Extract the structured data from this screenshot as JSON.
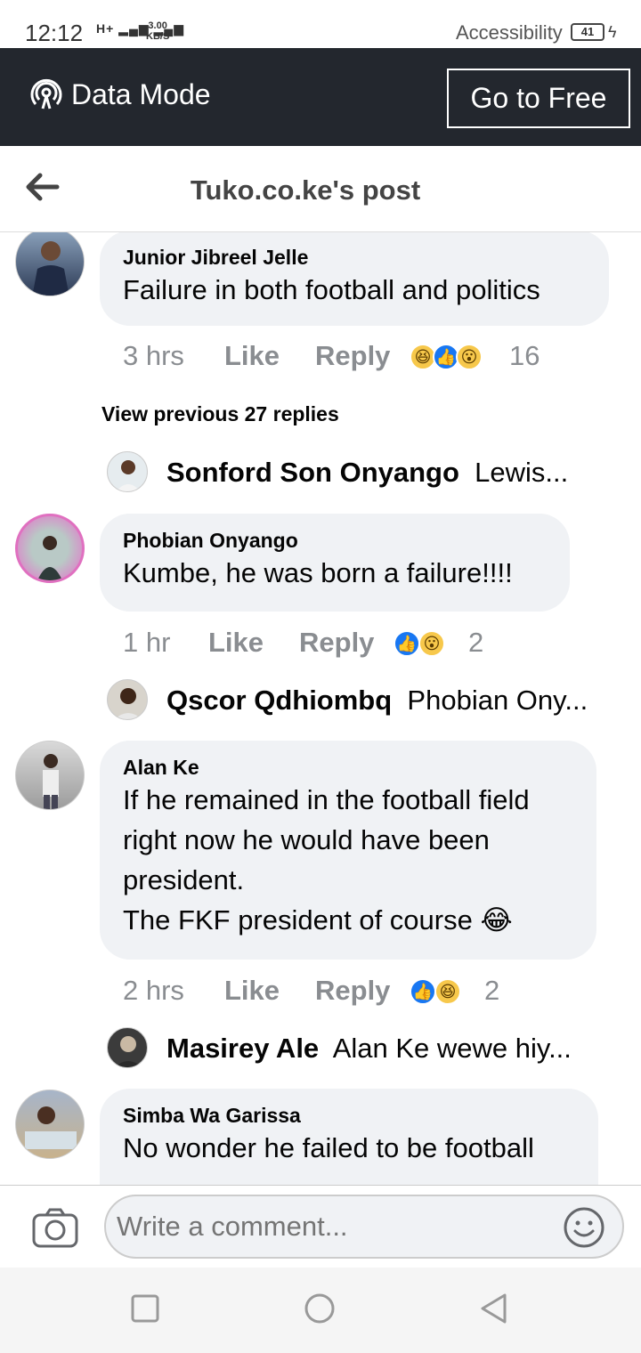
{
  "status": {
    "time": "12:12",
    "network": "H+",
    "speed_value": "3.00",
    "speed_unit": "KB/S",
    "accessibility": "Accessibility",
    "battery": "41"
  },
  "databar": {
    "label": "Data Mode",
    "button": "Go to Free"
  },
  "header": {
    "title": "Tuko.co.ke's post"
  },
  "comments": [
    {
      "author": "Junior Jibreel Jelle",
      "text": "Failure in both football and politics",
      "time": "3 hrs",
      "like": "Like",
      "reply": "Reply",
      "count": "16"
    },
    {
      "author": "Phobian Onyango",
      "text": "Kumbe, he was born a failure!!!!",
      "time": "1 hr",
      "like": "Like",
      "reply": "Reply",
      "count": "2"
    },
    {
      "author": "Alan Ke",
      "text": "If he remained in the football field\nright now he would have been\npresident.\nThe FKF president of course 😂",
      "time": "2 hrs",
      "like": "Like",
      "reply": "Reply",
      "count": "2"
    },
    {
      "author": "Simba Wa Garissa",
      "text": "No wonder he failed to be football"
    }
  ],
  "view_previous": "View previous 27 replies",
  "replies": [
    {
      "name": "Sonford Son Onyango",
      "text": "Lewis..."
    },
    {
      "name": "Qscor Qdhiombq",
      "text": "Phobian Ony..."
    },
    {
      "name": "Masirey Ale",
      "text": "Alan Ke  wewe hiy..."
    }
  ],
  "composer": {
    "placeholder": "Write a comment..."
  },
  "colors": {
    "databar": "#23272e",
    "bubble": "#f0f2f5",
    "like_blue": "#1877f2",
    "muted": "#8a8d91"
  }
}
